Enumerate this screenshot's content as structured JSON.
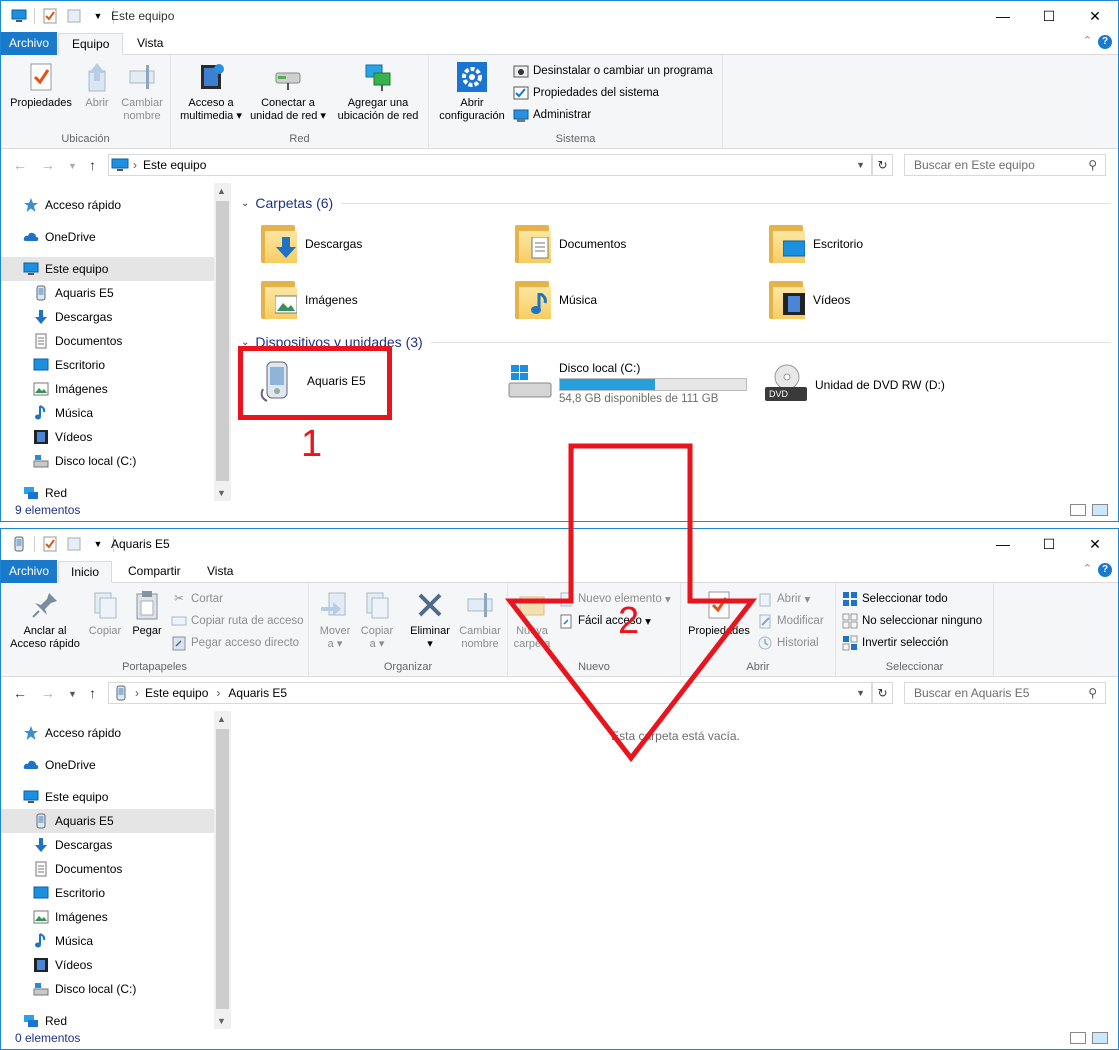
{
  "annotations": {
    "label1": "1",
    "label2": "2"
  },
  "colors": {
    "accent": "#1979ca",
    "annotation": "#e8141e",
    "selection": "#cce8ff",
    "drive_fill": "#26a0da"
  },
  "window1": {
    "title": "Este equipo",
    "tabs": {
      "file": "Archivo",
      "t1": "Equipo",
      "t2": "Vista"
    },
    "ribbon": {
      "ubicacion": {
        "label": "Ubicación",
        "propiedades": "Propiedades",
        "abrir": "Abrir",
        "cambiar1": "Cambiar",
        "cambiar2": "nombre"
      },
      "red": {
        "label": "Red",
        "acceso1": "Acceso a",
        "acceso2": "multimedia",
        "conectar1": "Conectar a",
        "conectar2": "unidad de red",
        "agregar1": "Agregar una",
        "agregar2": "ubicación de red"
      },
      "sistema": {
        "label": "Sistema",
        "abrir1": "Abrir",
        "abrir2": "configuración",
        "desinstalar": "Desinstalar o cambiar un programa",
        "propiedades": "Propiedades del sistema",
        "administrar": "Administrar"
      }
    },
    "address": {
      "path": "Este equipo",
      "search_placeholder": "Buscar en Este equipo"
    },
    "tree": [
      "Acceso rápido",
      "OneDrive",
      "Este equipo",
      "Aquaris E5",
      "Descargas",
      "Documentos",
      "Escritorio",
      "Imágenes",
      "Música",
      "Vídeos",
      "Disco local (C:)",
      "Red"
    ],
    "folders_header": "Carpetas (6)",
    "folders": [
      "Descargas",
      "Documentos",
      "Escritorio",
      "Imágenes",
      "Música",
      "Vídeos"
    ],
    "devices_header": "Dispositivos y unidades (3)",
    "devices": {
      "phone": "Aquaris E5",
      "disk": {
        "name": "Disco local (C:)",
        "free": "54,8 GB disponibles de 111 GB",
        "used_fraction": 0.51
      },
      "dvd": {
        "name": "Unidad de DVD RW (D:)",
        "badge": "DVD"
      }
    },
    "status": "9 elementos"
  },
  "window2": {
    "title": "Aquaris E5",
    "tabs": {
      "file": "Archivo",
      "t1": "Inicio",
      "t2": "Compartir",
      "t3": "Vista"
    },
    "ribbon": {
      "portapapeles": {
        "label": "Portapapeles",
        "anclar1": "Anclar al",
        "anclar2": "Acceso rápido",
        "copiar": "Copiar",
        "pegar": "Pegar",
        "cortar": "Cortar",
        "copiar_ruta": "Copiar ruta de acceso",
        "pegar_acceso": "Pegar acceso directo"
      },
      "organizar": {
        "label": "Organizar",
        "mover1": "Mover",
        "mover2": "a",
        "copiar1": "Copiar",
        "copiar2": "a",
        "eliminar": "Eliminar",
        "cambiar1": "Cambiar",
        "cambiar2": "nombre"
      },
      "nuevo": {
        "label": "Nuevo",
        "nueva1": "Nueva",
        "nueva2": "carpeta",
        "nuevo_elemento": "Nuevo elemento",
        "facil": "Fácil acceso"
      },
      "abrir": {
        "label": "Abrir",
        "propiedades": "Propiedades",
        "abrir": "Abrir",
        "modificar": "Modificar",
        "historial": "Historial"
      },
      "seleccionar": {
        "label": "Seleccionar",
        "todo": "Seleccionar todo",
        "ninguno": "No seleccionar ninguno",
        "invertir": "Invertir selección"
      }
    },
    "address": {
      "crumb1": "Este equipo",
      "crumb2": "Aquaris E5",
      "search_placeholder": "Buscar en Aquaris E5"
    },
    "tree": [
      "Acceso rápido",
      "OneDrive",
      "Este equipo",
      "Aquaris E5",
      "Descargas",
      "Documentos",
      "Escritorio",
      "Imágenes",
      "Música",
      "Vídeos",
      "Disco local (C:)",
      "Red"
    ],
    "empty": "Esta carpeta está vacía.",
    "status": "0 elementos"
  }
}
